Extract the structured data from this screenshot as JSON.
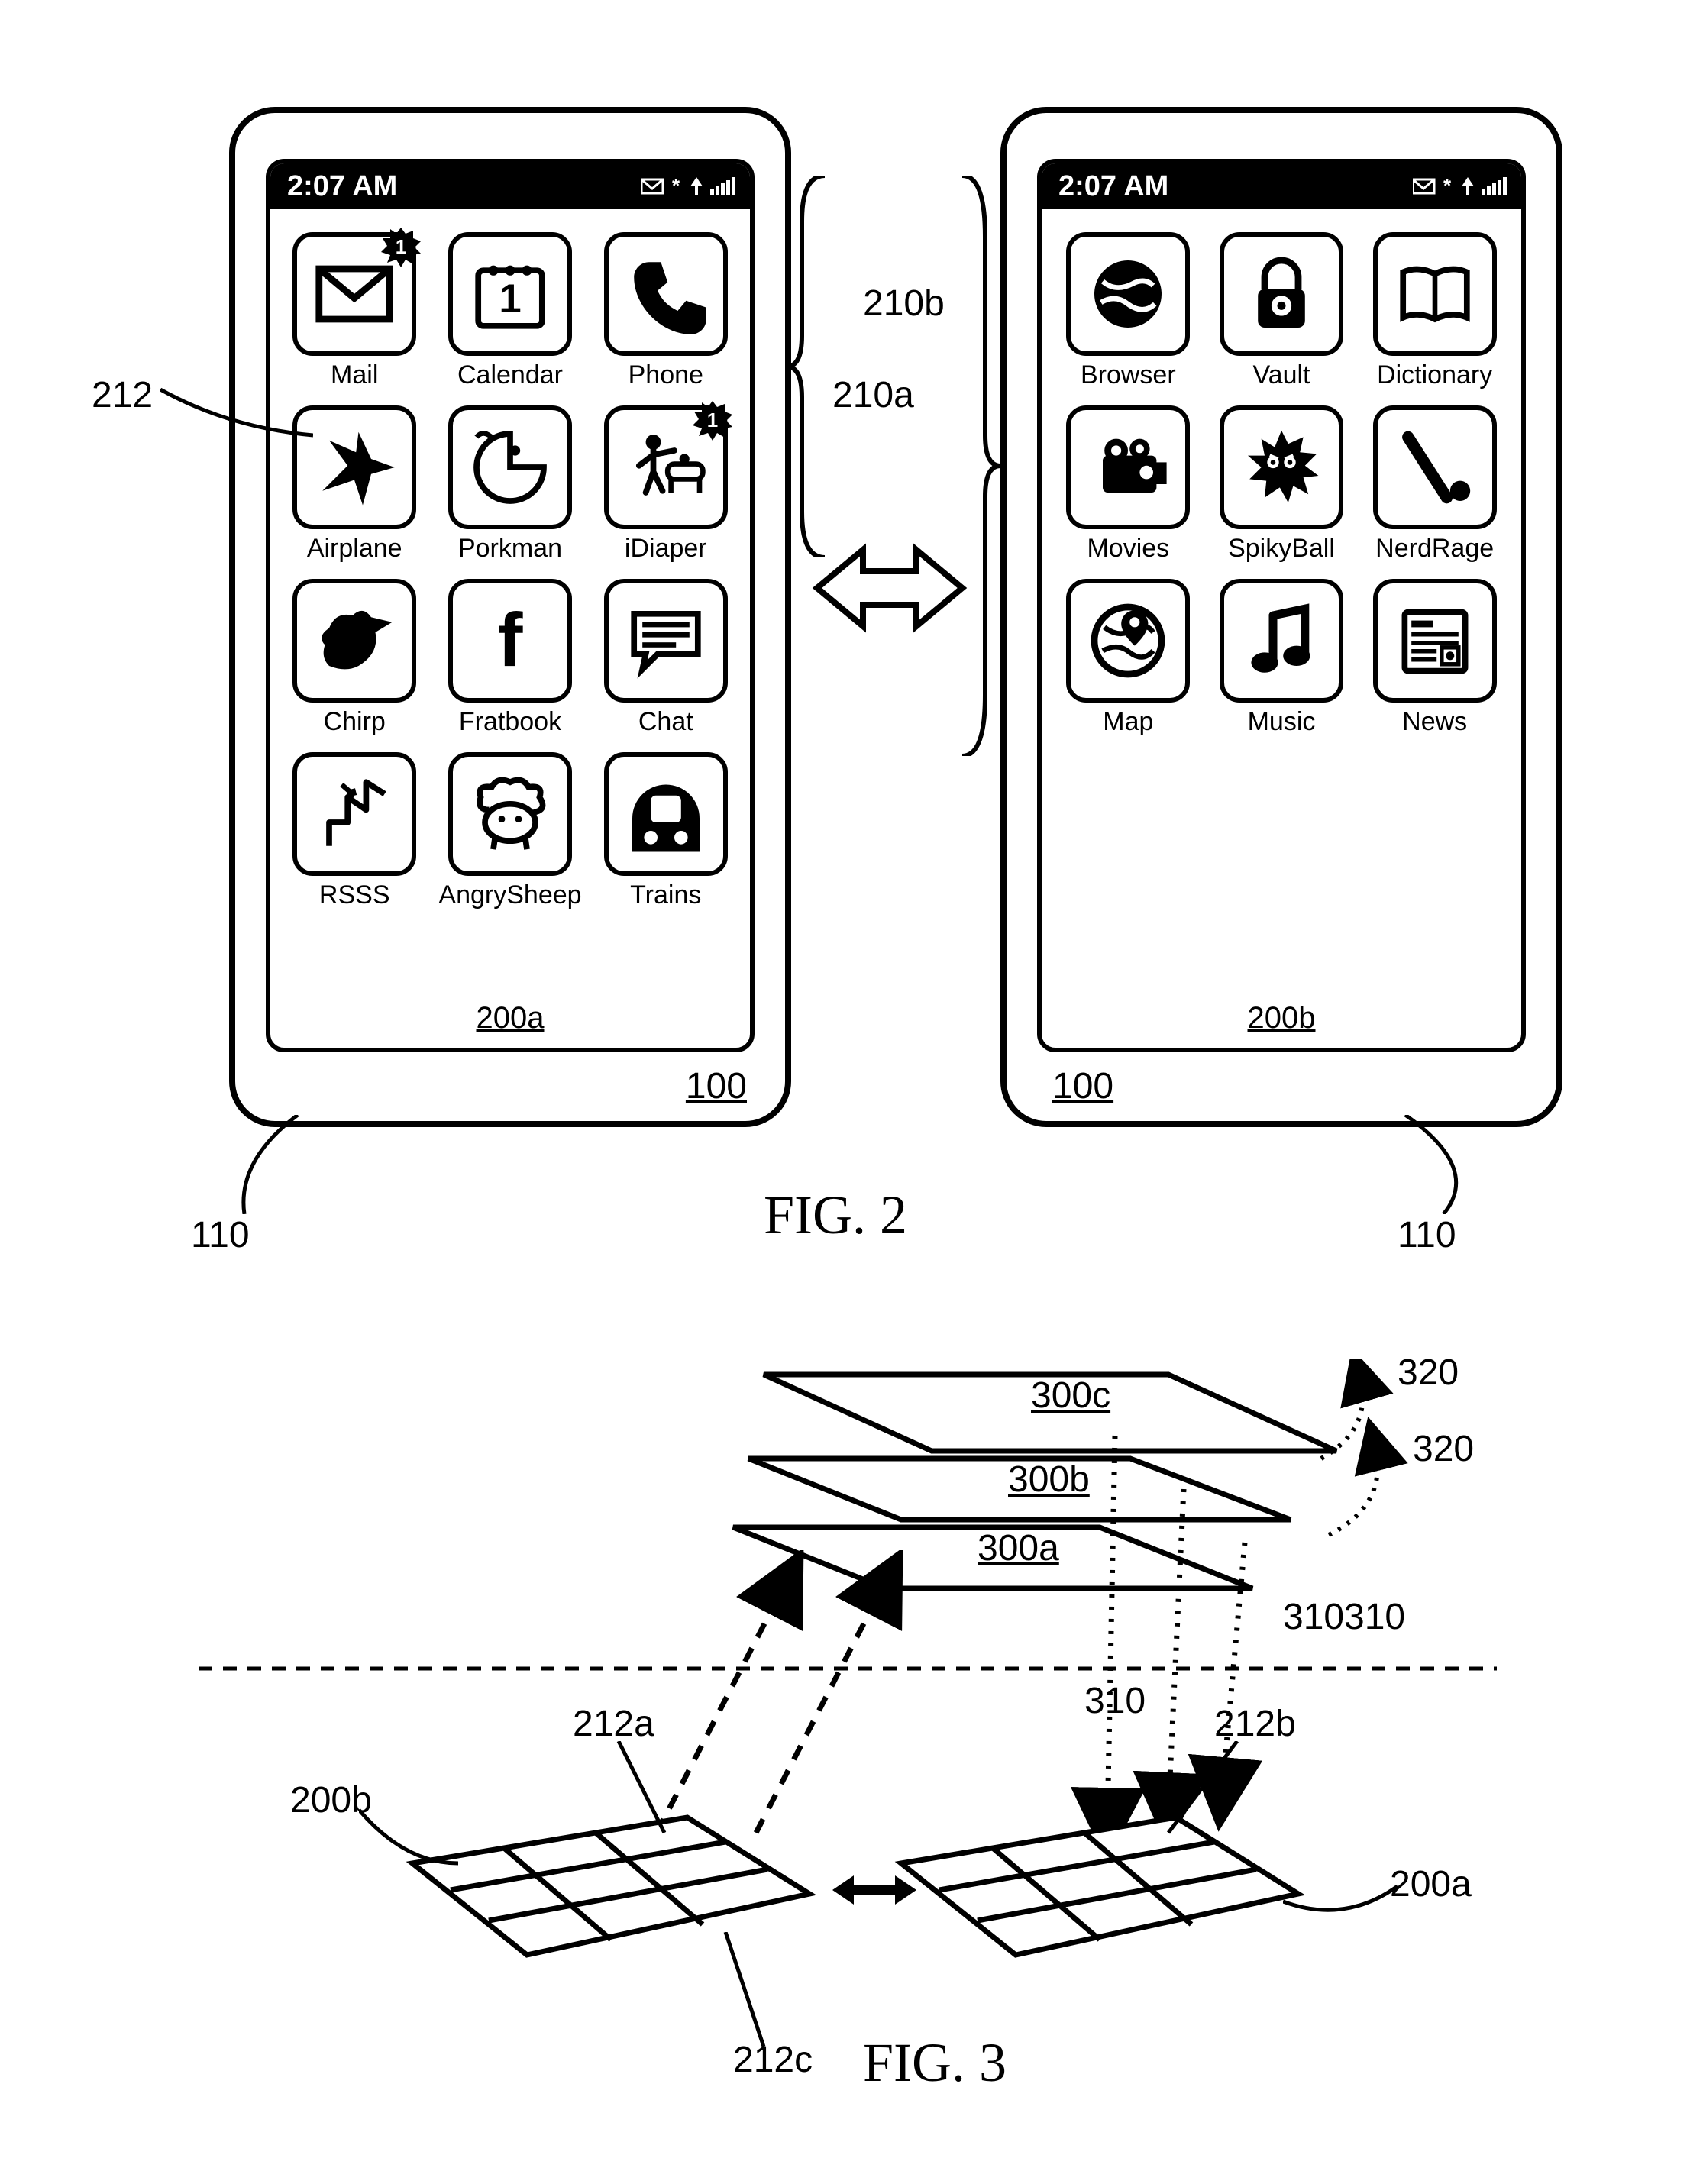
{
  "fig2": {
    "label": "FIG. 2",
    "time": "2:07 AM",
    "refs": {
      "r212": "212",
      "r210a": "210a",
      "r210b": "210b",
      "r100_left": "100",
      "r100_right": "100",
      "r110_left": "110",
      "r110_right": "110",
      "r200a": "200a",
      "r200b": "200b"
    },
    "phoneA": {
      "apps": [
        {
          "label": "Mail",
          "icon": "mail",
          "badge": "1"
        },
        {
          "label": "Calendar",
          "icon": "calendar"
        },
        {
          "label": "Phone",
          "icon": "phone"
        },
        {
          "label": "Airplane",
          "icon": "airplane"
        },
        {
          "label": "Porkman",
          "icon": "porkman"
        },
        {
          "label": "iDiaper",
          "icon": "idiaper",
          "badge": "1"
        },
        {
          "label": "Chirp",
          "icon": "chirp"
        },
        {
          "label": "Fratbook",
          "icon": "fratbook"
        },
        {
          "label": "Chat",
          "icon": "chat"
        },
        {
          "label": "RSSS",
          "icon": "rsss"
        },
        {
          "label": "AngrySheep",
          "icon": "angrysheep"
        },
        {
          "label": "Trains",
          "icon": "trains"
        }
      ]
    },
    "phoneB": {
      "apps": [
        {
          "label": "Browser",
          "icon": "browser"
        },
        {
          "label": "Vault",
          "icon": "vault"
        },
        {
          "label": "Dictionary",
          "icon": "dictionary"
        },
        {
          "label": "Movies",
          "icon": "movies"
        },
        {
          "label": "SpikyBall",
          "icon": "spikyball"
        },
        {
          "label": "NerdRage",
          "icon": "nerdrage"
        },
        {
          "label": "Map",
          "icon": "map"
        },
        {
          "label": "Music",
          "icon": "music"
        },
        {
          "label": "News",
          "icon": "news"
        }
      ]
    }
  },
  "fig3": {
    "label": "FIG. 3",
    "refs": {
      "r300a": "300a",
      "r300b": "300b",
      "r300c": "300c",
      "r320_1": "320",
      "r320_2": "320",
      "r310_1": "310",
      "r310_2": "310",
      "r310_3": "310",
      "r212a": "212a",
      "r212b": "212b",
      "r212c": "212c",
      "r200a": "200a",
      "r200b": "200b"
    }
  }
}
